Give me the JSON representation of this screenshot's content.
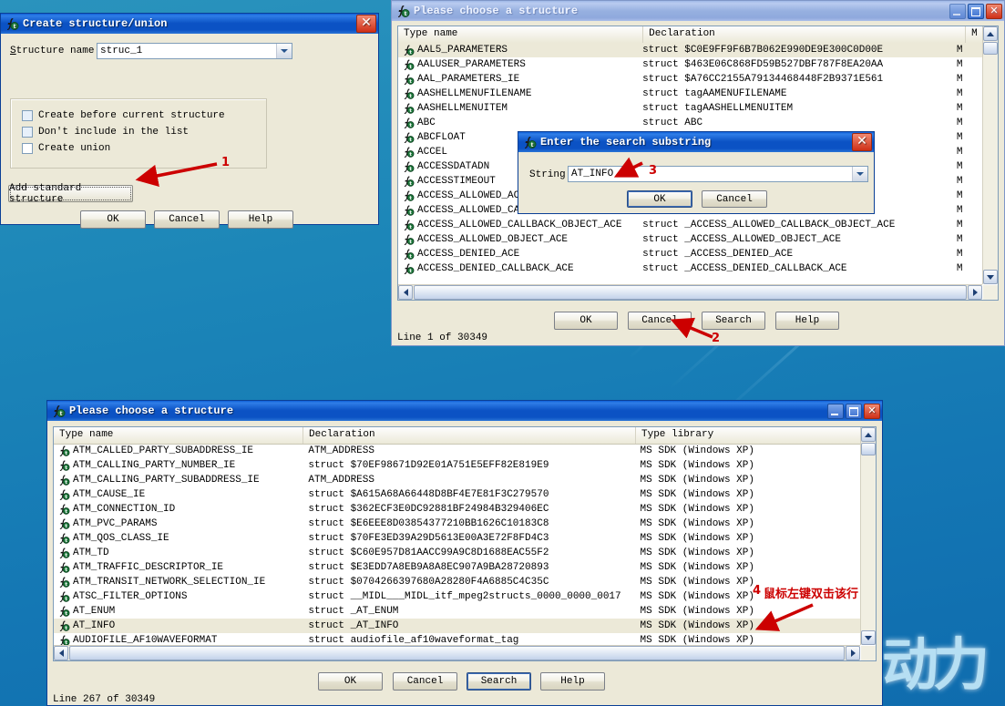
{
  "desktop": {
    "watermark": "动力"
  },
  "dialog_create": {
    "title": "Create structure/union",
    "icon": "ida-function-icon",
    "field_label": "Structure name",
    "field_value": "struc_1",
    "checkboxes": [
      {
        "label": "Create before current structure",
        "checked": false
      },
      {
        "label": "Don't include in the list",
        "checked": false
      },
      {
        "label": "Create union",
        "checked": false
      }
    ],
    "add_standard_button": "Add standard structure",
    "ok": "OK",
    "cancel": "Cancel",
    "help": "Help"
  },
  "dialog_choose_top": {
    "title": "Please choose a structure",
    "icon": "ida-function-icon",
    "columns": [
      "Type name",
      "Declaration",
      "M"
    ],
    "rows": [
      {
        "type": "AAL5_PARAMETERS",
        "decl": "struct $C0E9FF9F6B7B062E990DE9E300C0D00E",
        "lib": "M",
        "selected": true
      },
      {
        "type": "AALUSER_PARAMETERS",
        "decl": "struct $463E06C868FD59B527DBF787F8EA20AA",
        "lib": "M"
      },
      {
        "type": "AAL_PARAMETERS_IE",
        "decl": "struct $A76CC2155A79134468448F2B9371E561",
        "lib": "M"
      },
      {
        "type": "AASHELLMENUFILENAME",
        "decl": "struct tagAAMENUFILENAME",
        "lib": "M"
      },
      {
        "type": "AASHELLMENUITEM",
        "decl": "struct tagAASHELLMENUITEM",
        "lib": "M"
      },
      {
        "type": "ABC",
        "decl": "struct ABC",
        "lib": "M"
      },
      {
        "type": "ABCFLOAT",
        "decl": "",
        "lib": "M"
      },
      {
        "type": "ACCEL",
        "decl": "",
        "lib": "M"
      },
      {
        "type": "ACCESSDATADN",
        "decl": "",
        "lib": "M"
      },
      {
        "type": "ACCESSTIMEOUT",
        "decl": "",
        "lib": "M"
      },
      {
        "type": "ACCESS_ALLOWED_ACE",
        "decl": "",
        "lib": "M"
      },
      {
        "type": "ACCESS_ALLOWED_CALLBACK_ACE",
        "decl": "",
        "lib": "M"
      },
      {
        "type": "ACCESS_ALLOWED_CALLBACK_OBJECT_ACE",
        "decl": "struct _ACCESS_ALLOWED_CALLBACK_OBJECT_ACE",
        "lib": "M"
      },
      {
        "type": "ACCESS_ALLOWED_OBJECT_ACE",
        "decl": "struct _ACCESS_ALLOWED_OBJECT_ACE",
        "lib": "M"
      },
      {
        "type": "ACCESS_DENIED_ACE",
        "decl": "struct _ACCESS_DENIED_ACE",
        "lib": "M"
      },
      {
        "type": "ACCESS_DENIED_CALLBACK_ACE",
        "decl": "struct _ACCESS_DENIED_CALLBACK_ACE",
        "lib": "M"
      }
    ],
    "buttons": {
      "ok": "OK",
      "cancel": "Cancel",
      "search": "Search",
      "help": "Help"
    },
    "status": "Line 1 of 30349"
  },
  "dialog_search": {
    "title": "Enter the search substring",
    "icon": "ida-function-icon",
    "field_label": "String",
    "field_value": "AT_INFO",
    "ok": "OK",
    "cancel": "Cancel"
  },
  "dialog_choose_bottom": {
    "title": "Please choose a structure",
    "icon": "ida-function-icon",
    "columns": [
      "Type name",
      "Declaration",
      "Type library"
    ],
    "rows": [
      {
        "type": "ATM_CALLED_PARTY_SUBADDRESS_IE",
        "decl": "ATM_ADDRESS",
        "lib": "MS SDK (Windows XP)"
      },
      {
        "type": "ATM_CALLING_PARTY_NUMBER_IE",
        "decl": "struct $70EF98671D92E01A751E5EFF82E819E9",
        "lib": "MS SDK (Windows XP)"
      },
      {
        "type": "ATM_CALLING_PARTY_SUBADDRESS_IE",
        "decl": "ATM_ADDRESS",
        "lib": "MS SDK (Windows XP)"
      },
      {
        "type": "ATM_CAUSE_IE",
        "decl": "struct $A615A68A66448D8BF4E7E81F3C279570",
        "lib": "MS SDK (Windows XP)"
      },
      {
        "type": "ATM_CONNECTION_ID",
        "decl": "struct $362ECF3E0DC92881BF24984B329406EC",
        "lib": "MS SDK (Windows XP)"
      },
      {
        "type": "ATM_PVC_PARAMS",
        "decl": "struct $E6EEE8D03854377210BB1626C10183C8",
        "lib": "MS SDK (Windows XP)"
      },
      {
        "type": "ATM_QOS_CLASS_IE",
        "decl": "struct $70FE3ED39A29D5613E00A3E72F8FD4C3",
        "lib": "MS SDK (Windows XP)"
      },
      {
        "type": "ATM_TD",
        "decl": "struct $C60E957D81AACC99A9C8D1688EAC55F2",
        "lib": "MS SDK (Windows XP)"
      },
      {
        "type": "ATM_TRAFFIC_DESCRIPTOR_IE",
        "decl": "struct $E3EDD7A8EB9A8A8EC907A9BA28720893",
        "lib": "MS SDK (Windows XP)"
      },
      {
        "type": "ATM_TRANSIT_NETWORK_SELECTION_IE",
        "decl": "struct $0704266397680A28280F4A6885C4C35C",
        "lib": "MS SDK (Windows XP)"
      },
      {
        "type": "ATSC_FILTER_OPTIONS",
        "decl": "struct __MIDL___MIDL_itf_mpeg2structs_0000_0000_0017",
        "lib": "MS SDK (Windows XP)"
      },
      {
        "type": "AT_ENUM",
        "decl": "struct _AT_ENUM",
        "lib": "MS SDK (Windows XP)"
      },
      {
        "type": "AT_INFO",
        "decl": "struct _AT_INFO",
        "lib": "MS SDK (Windows XP)",
        "selected": true
      },
      {
        "type": "AUDIOFILE_AF10WAVEFORMAT",
        "decl": "struct audiofile_af10waveformat_tag",
        "lib": "MS SDK (Windows XP)"
      }
    ],
    "buttons": {
      "ok": "OK",
      "cancel": "Cancel",
      "search": "Search",
      "help": "Help"
    },
    "status": "Line 267 of 30349"
  },
  "annotations": {
    "one": "1",
    "two": "2",
    "three": "3",
    "four": "4",
    "four_text": "鼠标左键双击该行",
    "color": "#cc0000"
  }
}
